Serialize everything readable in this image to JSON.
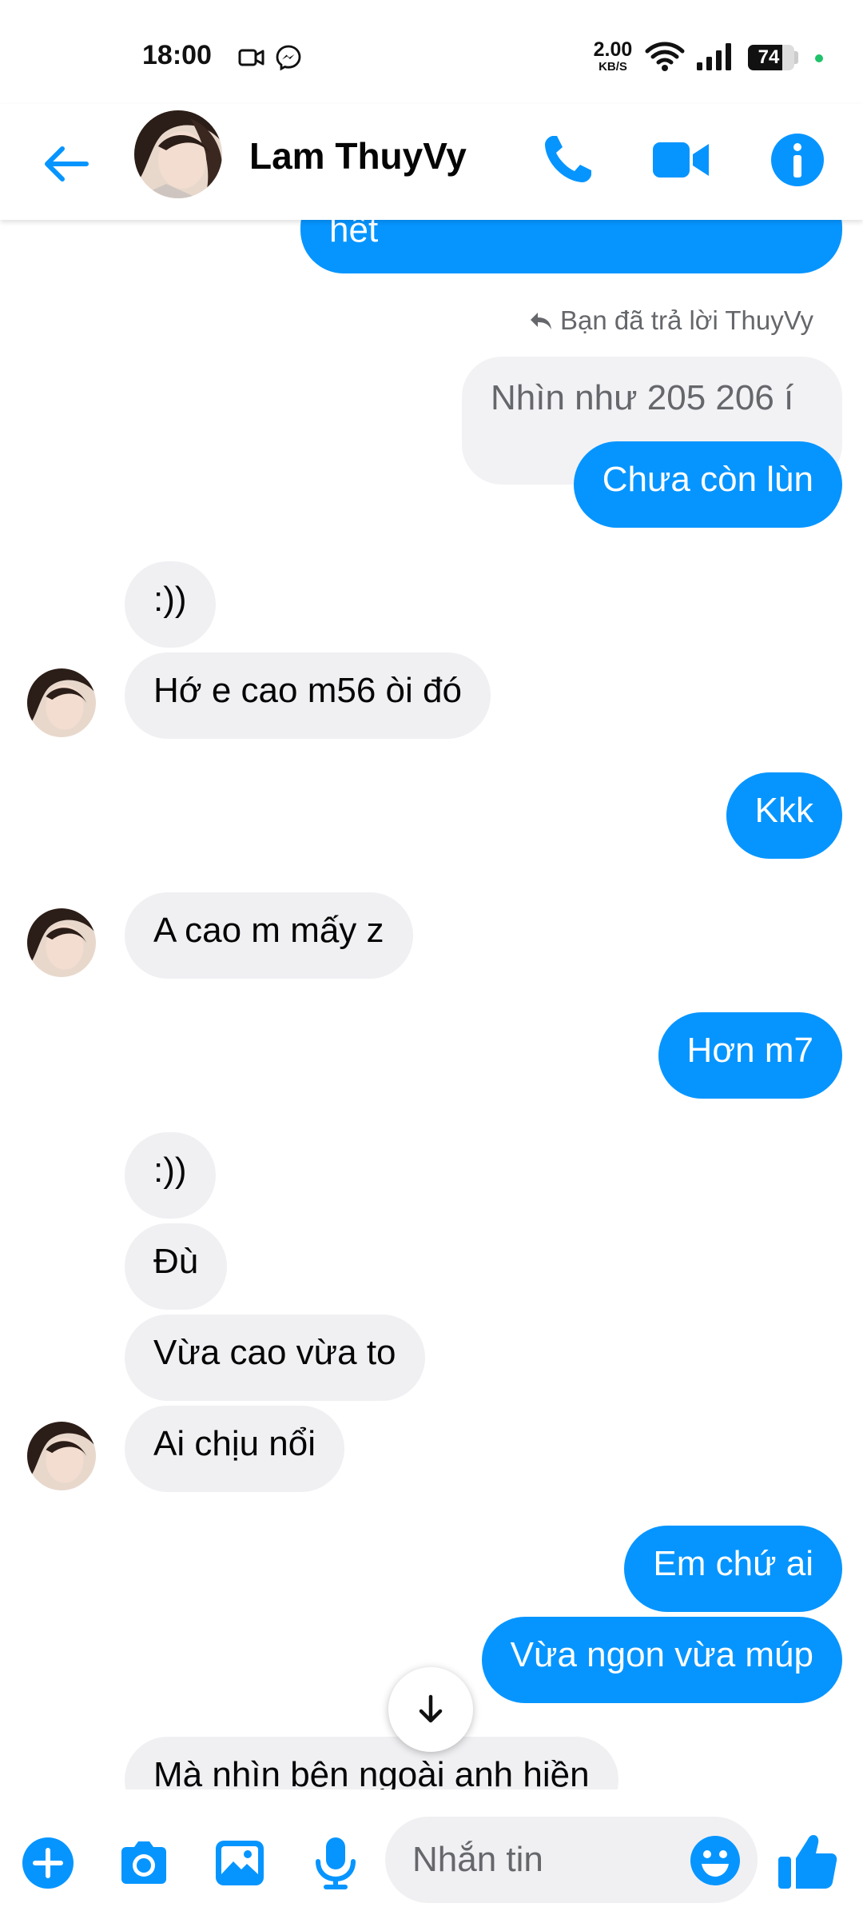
{
  "status_bar": {
    "time": "18:00",
    "net_speed_value": "2.00",
    "net_speed_unit": "KB/S",
    "battery_level": "74",
    "battery_fraction": 0.74,
    "icons": [
      "video-camera-icon",
      "messenger-icon",
      "wifi-icon",
      "signal-icon",
      "battery-icon"
    ]
  },
  "header": {
    "contact_name": "Lam ThuyVy",
    "icons": [
      "back-arrow-icon",
      "phone-icon",
      "video-call-icon",
      "info-icon"
    ]
  },
  "colors": {
    "accent": "#0695ff",
    "outgoing_bubble": "#0695ff",
    "incoming_bubble": "#f0f0f3",
    "secondary_text": "#65676b"
  },
  "conversation": {
    "top_partial_message": "hết",
    "reply_note": "Bạn đã trả lời ThuyVy",
    "quoted_message": "Nhìn như 205 206 í",
    "messages": [
      {
        "sender": "me",
        "text": "Chưa còn lùn"
      },
      {
        "sender": "them",
        "text": ":))"
      },
      {
        "sender": "them",
        "text": "Hớ e cao m56 òi đó"
      },
      {
        "sender": "me",
        "text": "Kkk"
      },
      {
        "sender": "them",
        "text": "A cao m mấy z"
      },
      {
        "sender": "me",
        "text": "Hơn m7"
      },
      {
        "sender": "them",
        "text": ":))"
      },
      {
        "sender": "them",
        "text": "Đù"
      },
      {
        "sender": "them",
        "text": "Vừa cao vừa to"
      },
      {
        "sender": "them",
        "text": "Ai chịu nổi"
      },
      {
        "sender": "me",
        "text": "Em chứ ai"
      },
      {
        "sender": "me",
        "text": "Vừa ngon vừa múp"
      },
      {
        "sender": "them",
        "text": "Mà nhìn bên ngoài anh hiền"
      }
    ]
  },
  "composer": {
    "placeholder": "Nhắn tin",
    "icons": [
      "plus-icon",
      "camera-icon",
      "gallery-icon",
      "microphone-icon",
      "emoji-icon",
      "thumbs-up-icon"
    ]
  }
}
